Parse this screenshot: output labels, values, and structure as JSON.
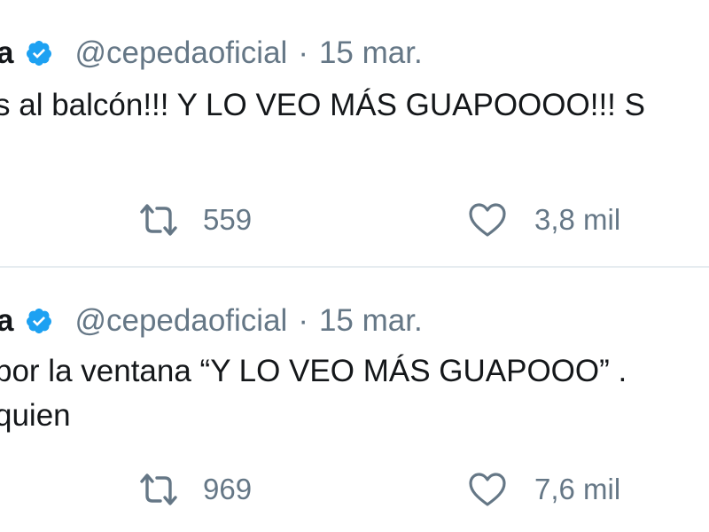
{
  "tweets": [
    {
      "name_fragment": "a",
      "handle": "@cepedaoficial",
      "separator": "·",
      "date": "15 mar.",
      "text_lines": [
        "s al balcón!!! Y LO VEO MÁS GUAPOOOO!!! S"
      ],
      "retweets": "559",
      "likes": "3,8 mil"
    },
    {
      "name_fragment": "a",
      "handle": "@cepedaoficial",
      "separator": "·",
      "date": "15 mar.",
      "text_lines": [
        "por la ventana “Y LO VEO MÁS GUAPOOO” .",
        "quien"
      ],
      "retweets": "969",
      "likes": "7,6 mil"
    }
  ],
  "icons": {
    "verified": "verified-badge-icon",
    "retweet": "retweet-icon",
    "like": "heart-icon"
  },
  "colors": {
    "verified": "#1da1f2",
    "text": "#14171a",
    "secondary": "#657786",
    "divider": "#e6ecf0"
  }
}
